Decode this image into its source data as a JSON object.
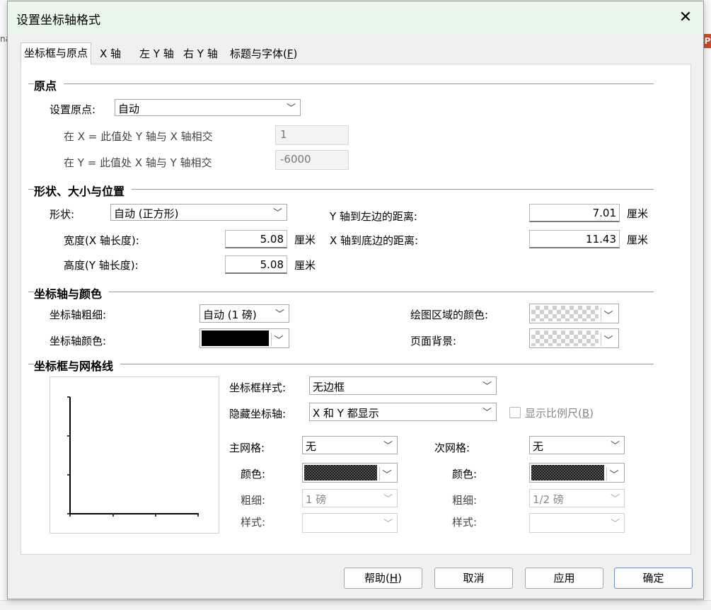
{
  "dialog": {
    "title": "设置坐标轴格式",
    "close_glyph": "✕"
  },
  "tabs": [
    {
      "label": "坐标框与原点",
      "active": true
    },
    {
      "label": "X 轴"
    },
    {
      "label": "左 Y 轴"
    },
    {
      "label": "右 Y 轴"
    },
    {
      "label_pre": "标题与字体(",
      "label_key": "F",
      "label_post": ")"
    }
  ],
  "origin": {
    "section": "原点",
    "set_label": "设置原点:",
    "set_value": "自动",
    "x_label": "在 X = 此值处 Y 轴与 X 轴相交",
    "x_value": "1",
    "y_label": "在 Y = 此值处 X 轴与 Y 轴相交",
    "y_value": "-6000"
  },
  "shape": {
    "section": "形状、大小与位置",
    "shape_label": "形状:",
    "shape_value": "自动 (正方形)",
    "width_label": "宽度(X 轴长度):",
    "width_value": "5.08",
    "height_label": "高度(Y 轴长度):",
    "height_value": "5.08",
    "y_left_label": "Y 轴到左边的距离:",
    "y_left_value": "7.01",
    "x_bottom_label": "X 轴到底边的距离:",
    "x_bottom_value": "11.43",
    "unit": "厘米"
  },
  "axis_color": {
    "section": "坐标轴与颜色",
    "thickness_label": "坐标轴粗细:",
    "thickness_value": "自动 (1 磅)",
    "color_label": "坐标轴颜色:",
    "plot_color_label": "绘图区域的颜色:",
    "page_bg_label": "页面背景:"
  },
  "frame": {
    "section": "坐标框与网格线",
    "style_label": "坐标框样式:",
    "style_value": "无边框",
    "hide_label": "隐藏坐标轴:",
    "hide_value": "X 和 Y 都显示",
    "scale_pre": "显示比例尺(",
    "scale_key": "B",
    "scale_post": ")",
    "major_label": "主网格:",
    "major_value": "无",
    "minor_label": "次网格:",
    "minor_value": "无",
    "color_label": "颜色:",
    "weight_label": "粗细:",
    "major_weight": "1 磅",
    "minor_weight": "1/2 磅",
    "pattern_label": "样式:"
  },
  "buttons": {
    "help_pre": "帮助(",
    "help_key": "H",
    "help_post": ")",
    "cancel": "取消",
    "apply": "应用",
    "ok": "确定"
  },
  "icons": {
    "dropdown": "﹀"
  }
}
